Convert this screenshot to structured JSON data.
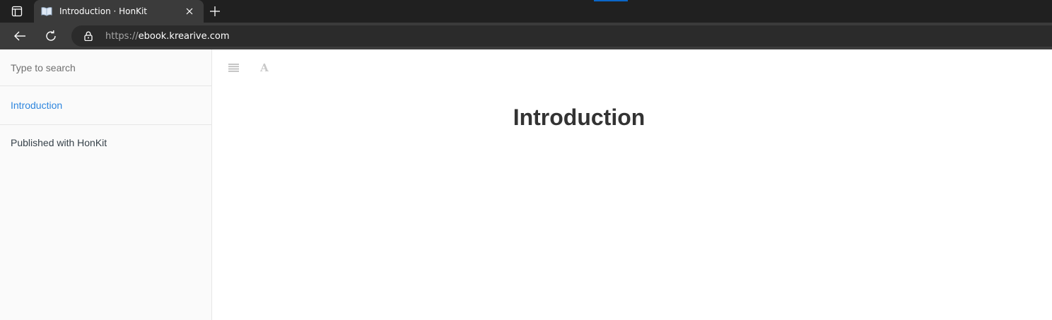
{
  "browser": {
    "tab": {
      "title": "Introduction · HonKit"
    },
    "address": {
      "scheme": "https://",
      "host": "ebook.krearive.com"
    },
    "colors": {
      "tabstrip": "#202020",
      "toolbar": "#3b3b3b",
      "accent": "#0a66c8"
    }
  },
  "book": {
    "search": {
      "placeholder": "Type to search"
    },
    "summary": {
      "items": [
        {
          "label": "Introduction",
          "active": true
        }
      ]
    },
    "published_label": "Published with HonKit",
    "header": {
      "font_button_glyph": "A"
    },
    "content": {
      "title": "Introduction"
    },
    "colors": {
      "link": "#2e86de",
      "text": "#333333",
      "sidebar_bg": "#fafafa"
    }
  },
  "icons": [
    "sidebar-toggle-icon",
    "book-icon",
    "close-icon",
    "plus-icon",
    "back-arrow-icon",
    "reload-icon",
    "lock-icon",
    "list-icon",
    "font-settings-icon"
  ]
}
